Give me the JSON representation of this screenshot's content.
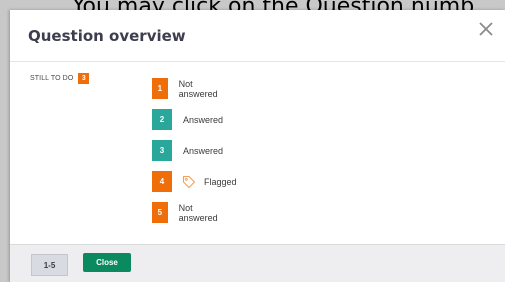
{
  "background": {
    "partial_text": "You may click on the Question numb"
  },
  "dialog": {
    "title": "Question overview",
    "close_icon": "close-x-icon",
    "still_to_do": {
      "label": "STILL TO DO",
      "count": "3"
    },
    "questions": [
      {
        "number": "1",
        "status": "Not answered",
        "color": "#f06e0a",
        "flagged": false
      },
      {
        "number": "2",
        "status": "Answered",
        "color": "#2aa79b",
        "flagged": false
      },
      {
        "number": "3",
        "status": "Answered",
        "color": "#2aa79b",
        "flagged": false
      },
      {
        "number": "4",
        "status": "Flagged",
        "color": "#f06e0a",
        "flagged": true,
        "flag_icon": "tag-icon"
      },
      {
        "number": "5",
        "status": "Not answered",
        "color": "#f06e0a",
        "flagged": false
      }
    ],
    "footer": {
      "range_label": "1-5",
      "close_label": "Close"
    }
  },
  "colors": {
    "not_answered": "#f06e0a",
    "answered": "#2aa79b",
    "close_button": "#0c8a5f",
    "flag_icon": "#f3a05a"
  }
}
